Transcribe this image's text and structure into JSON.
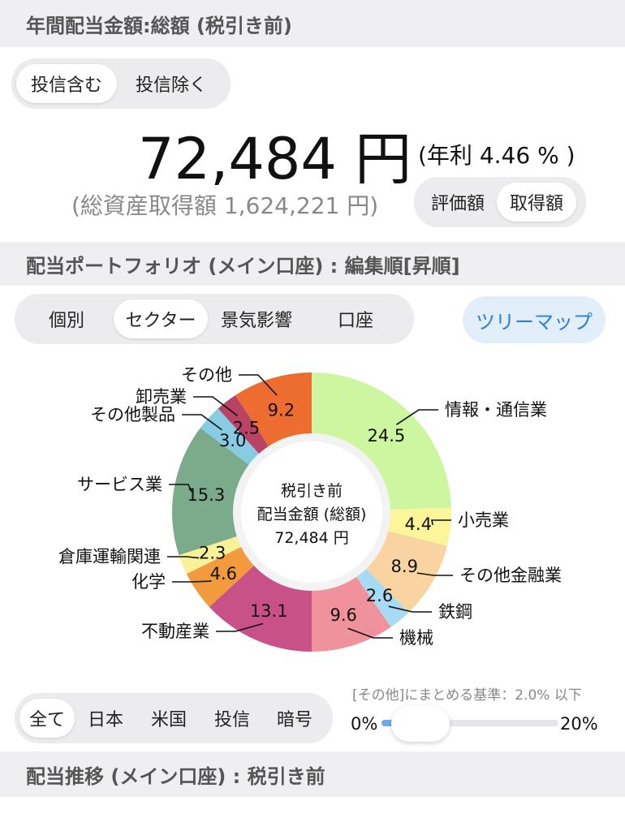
{
  "section1": {
    "title": "年間配当金額:総額 (税引き前)",
    "fund_toggle": [
      "投信含む",
      "投信除く"
    ],
    "fund_active": 0,
    "amount": "72,484 円",
    "annual_rate": "(年利 4.46 % )",
    "total_asset": "(総資産取得額 1,624,221 円)",
    "basis_toggle": [
      "評価額",
      "取得額"
    ],
    "basis_active": 1
  },
  "section2": {
    "title": "配当ポートフォリオ (メイン口座) : 編集順[昇順]",
    "view_tabs": [
      "個別",
      "セクター",
      "景気影響",
      "口座"
    ],
    "view_active": 1,
    "treemap_label": "ツリーマップ",
    "market_tabs": [
      "全て",
      "日本",
      "米国",
      "投信",
      "暗号"
    ],
    "market_active": 0,
    "threshold_label": "[その他]にまとめる基準：2.0% 以下",
    "slider_min": "0%",
    "slider_max": "20%",
    "slider_value": 2.0
  },
  "section3": {
    "title": "配当推移 (メイン口座) : 税引き前"
  },
  "chart_data": {
    "type": "pie",
    "style": "donut",
    "center_text": [
      "税引き前",
      "配当金額 (総額)",
      "72,484 円"
    ],
    "slices": [
      {
        "label": "情報・通信業",
        "value": 24.5,
        "color": "#ccf7a0"
      },
      {
        "label": "小売業",
        "value": 4.4,
        "color": "#fdf59a"
      },
      {
        "label": "その他金融業",
        "value": 8.9,
        "color": "#f9d4a0"
      },
      {
        "label": "鉄鋼",
        "value": 2.6,
        "color": "#a7dbf3"
      },
      {
        "label": "機械",
        "value": 9.6,
        "color": "#f0929c"
      },
      {
        "label": "不動産業",
        "value": 13.1,
        "color": "#c85288"
      },
      {
        "label": "化学",
        "value": 4.6,
        "color": "#f19a3e"
      },
      {
        "label": "倉庫運輸関連",
        "value": 2.3,
        "color": "#f7f29a"
      },
      {
        "label": "サービス業",
        "value": 15.3,
        "color": "#7bab8a"
      },
      {
        "label": "その他製品",
        "value": 3.0,
        "color": "#86cde4"
      },
      {
        "label": "卸売業",
        "value": 2.5,
        "color": "#b94364"
      },
      {
        "label": "その他",
        "value": 9.2,
        "color": "#ed6d31"
      }
    ]
  }
}
